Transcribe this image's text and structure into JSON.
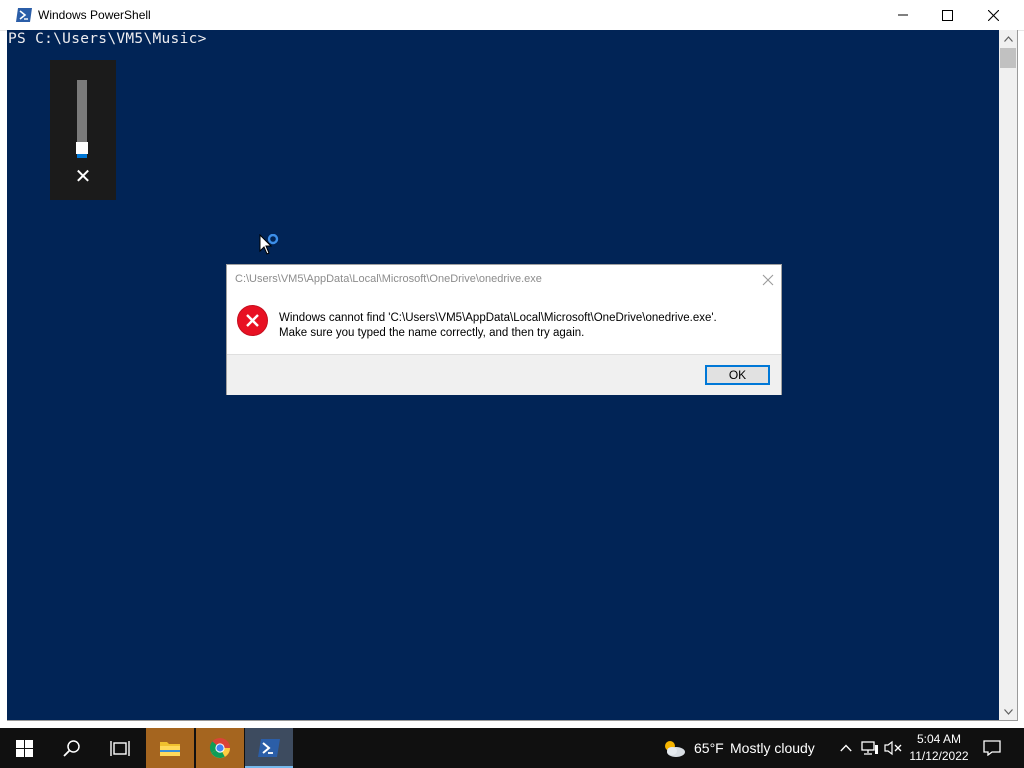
{
  "window": {
    "title": "Windows PowerShell",
    "icon": "powershell-icon"
  },
  "console": {
    "prompt": "PS C:\\Users\\VM5\\Music>",
    "background": "#012456",
    "foreground": "#eeedf0"
  },
  "volume_flyout": {
    "level_fraction": 0.0,
    "muted": true,
    "mute_icon": "close-icon"
  },
  "dialog": {
    "title": "C:\\Users\\VM5\\AppData\\Local\\Microsoft\\OneDrive\\onedrive.exe",
    "message_line1": "Windows cannot find 'C:\\Users\\VM5\\AppData\\Local\\Microsoft\\OneDrive\\onedrive.exe'.",
    "message_line2": "Make sure you typed the name correctly, and then try again.",
    "ok_label": "OK",
    "icon": "error-icon",
    "accent": "#0078d7"
  },
  "taskbar": {
    "apps": [
      "start-icon",
      "search-icon",
      "task-view-icon",
      "file-explorer-icon",
      "chrome-icon",
      "powershell-icon"
    ],
    "weather": {
      "temp": "65°F",
      "condition": "Mostly cloudy"
    },
    "clock": {
      "time": "5:04 AM",
      "date": "11/12/2022"
    }
  }
}
